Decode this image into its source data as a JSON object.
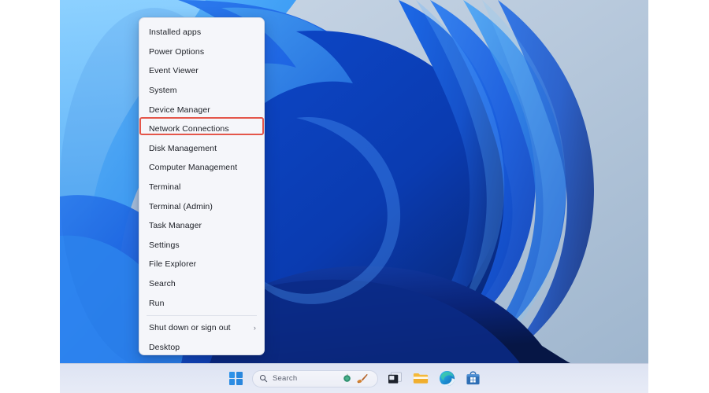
{
  "colors": {
    "menu_bg": "#f5f6fa",
    "menu_text": "#1c1f26",
    "highlight_border": "#e4564a",
    "taskbar_bg": "#e3e8f5",
    "wallpaper_primary": "#0b4fd6",
    "wallpaper_light": "#49a6f5",
    "wallpaper_pale": "#ccd9e8",
    "accent_blue": "#2a87dd"
  },
  "context_menu": {
    "name": "Win+X Power User Menu",
    "items": [
      {
        "label": "Installed apps",
        "submenu": false,
        "highlighted": false,
        "separator_after": false
      },
      {
        "label": "Power Options",
        "submenu": false,
        "highlighted": false,
        "separator_after": false
      },
      {
        "label": "Event Viewer",
        "submenu": false,
        "highlighted": false,
        "separator_after": false
      },
      {
        "label": "System",
        "submenu": false,
        "highlighted": false,
        "separator_after": false
      },
      {
        "label": "Device Manager",
        "submenu": false,
        "highlighted": false,
        "separator_after": false
      },
      {
        "label": "Network Connections",
        "submenu": false,
        "highlighted": true,
        "separator_after": false
      },
      {
        "label": "Disk Management",
        "submenu": false,
        "highlighted": false,
        "separator_after": false
      },
      {
        "label": "Computer Management",
        "submenu": false,
        "highlighted": false,
        "separator_after": false
      },
      {
        "label": "Terminal",
        "submenu": false,
        "highlighted": false,
        "separator_after": false
      },
      {
        "label": "Terminal (Admin)",
        "submenu": false,
        "highlighted": false,
        "separator_after": false
      },
      {
        "label": "Task Manager",
        "submenu": false,
        "highlighted": false,
        "separator_after": false
      },
      {
        "label": "Settings",
        "submenu": false,
        "highlighted": false,
        "separator_after": false
      },
      {
        "label": "File Explorer",
        "submenu": false,
        "highlighted": false,
        "separator_after": false
      },
      {
        "label": "Search",
        "submenu": false,
        "highlighted": false,
        "separator_after": false
      },
      {
        "label": "Run",
        "submenu": false,
        "highlighted": false,
        "separator_after": true
      },
      {
        "label": "Shut down or sign out",
        "submenu": true,
        "highlighted": false,
        "separator_after": false
      },
      {
        "label": "Desktop",
        "submenu": false,
        "highlighted": false,
        "separator_after": false
      }
    ],
    "submenu_glyph": "›"
  },
  "taskbar": {
    "search": {
      "placeholder": "Search",
      "value": "",
      "icon": "search-icon"
    },
    "buttons": [
      {
        "name": "start-button",
        "icon": "windows-logo-icon"
      },
      {
        "name": "taskview-button",
        "icon": "task-view-icon"
      },
      {
        "name": "file-explorer-button",
        "icon": "folder-icon"
      },
      {
        "name": "edge-button",
        "icon": "edge-browser-icon"
      },
      {
        "name": "store-button",
        "icon": "microsoft-store-icon"
      }
    ],
    "widget_icons": [
      {
        "name": "widget-weather-icon",
        "color": "#2f8f6e"
      },
      {
        "name": "widget-brush-icon",
        "color": "#c4702a"
      }
    ]
  }
}
